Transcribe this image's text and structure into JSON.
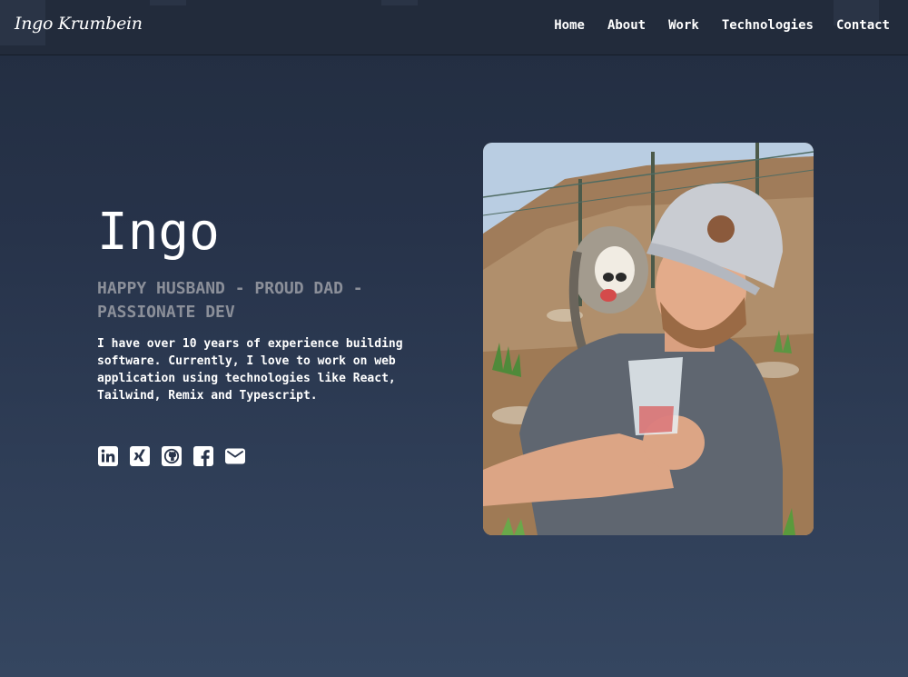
{
  "header": {
    "brand": "Ingo Krumbein",
    "nav": [
      {
        "label": "Home"
      },
      {
        "label": "About"
      },
      {
        "label": "Work"
      },
      {
        "label": "Technologies"
      },
      {
        "label": "Contact"
      }
    ]
  },
  "hero": {
    "name": "Ingo",
    "tagline": "HAPPY HUSBAND - PROUD DAD - PASSIONATE DEV",
    "bio": "I have over 10 years of experience building software. Currently, I love to work on web application using technologies like React, Tailwind, Remix and Typescript.",
    "socials": [
      {
        "icon": "linkedin-icon"
      },
      {
        "icon": "xing-icon"
      },
      {
        "icon": "github-icon"
      },
      {
        "icon": "facebook-icon"
      },
      {
        "icon": "mail-icon"
      }
    ]
  },
  "colors": {
    "background": "#27334a",
    "header": "#222b3b",
    "text": "#ffffff",
    "muted": "#8b8f99"
  }
}
